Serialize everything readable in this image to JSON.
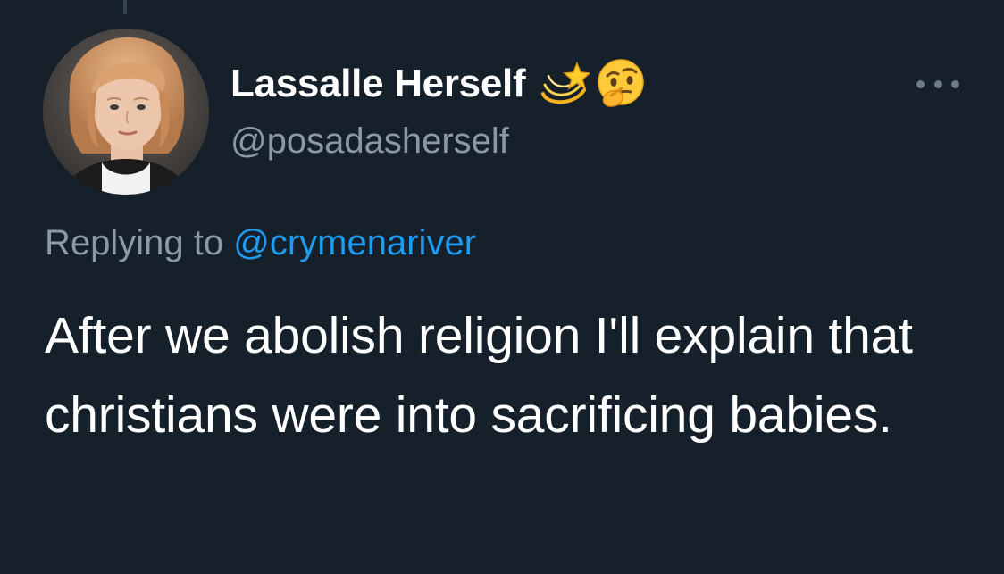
{
  "tweet": {
    "author": {
      "display_name": "Lassalle Herself",
      "name_emoji": [
        "dizzy-star-emoji",
        "thinking-face-emoji"
      ],
      "handle": "@posadasherself",
      "avatar": "profile-photo"
    },
    "reply": {
      "prefix": "Replying to",
      "mention": "@crymenariver"
    },
    "text": "After we abolish religion I'll explain that christians were into sacrificing babies.",
    "more_icon": "more-options-icon"
  },
  "colors": {
    "background": "#15202b",
    "text_primary": "#ffffff",
    "text_secondary": "#8b98a5",
    "link": "#1d9bf0"
  }
}
